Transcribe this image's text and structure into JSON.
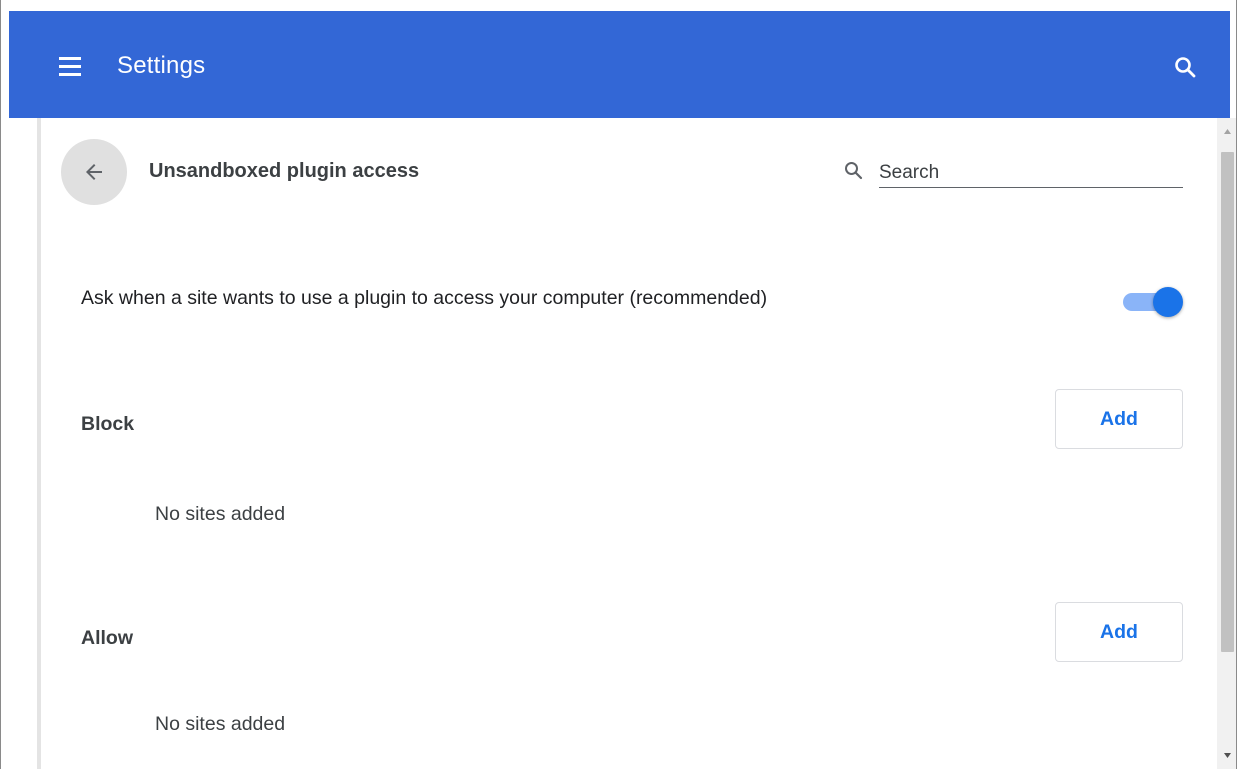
{
  "header": {
    "title": "Settings",
    "menu_icon": "hamburger-menu-icon",
    "search_icon": "search-icon"
  },
  "page": {
    "title": "Unsandboxed plugin access",
    "back_icon": "arrow-back-icon",
    "search_placeholder": "Search"
  },
  "setting": {
    "label": "Ask when a site wants to use a plugin to access your computer (recommended)",
    "enabled": true
  },
  "sections": [
    {
      "label": "Block",
      "button_label": "Add",
      "empty_text": "No sites added"
    },
    {
      "label": "Allow",
      "button_label": "Add",
      "empty_text": "No sites added"
    }
  ],
  "colors": {
    "header_bg": "#3367d6",
    "accent": "#1a73e8",
    "toggle_track": "#8ab4f8"
  }
}
